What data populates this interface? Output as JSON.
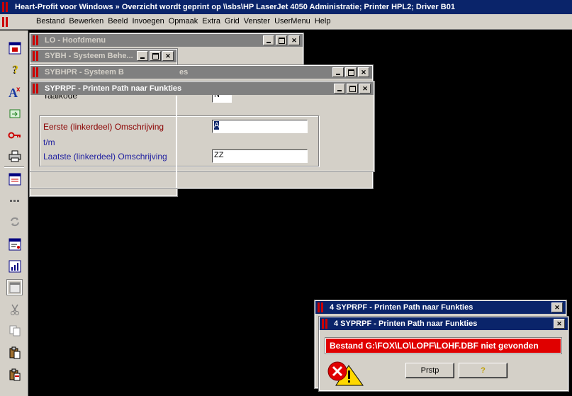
{
  "app": {
    "title": "Heart-Profit voor Windows  »  Overzicht wordt geprint op \\\\sbs\\HP LaserJet 4050 Administratie; Printer HPL2; Driver B01"
  },
  "menu": {
    "items": [
      "Bestand",
      "Bewerken",
      "Beeld",
      "Invoegen",
      "Opmaak",
      "Extra",
      "Grid",
      "Venster",
      "UserMenu",
      "Help"
    ]
  },
  "toolbar": {
    "icons": [
      "frame-icon",
      "help-icon",
      "font-icon",
      "move-icon",
      "key-icon",
      "printer-icon",
      "form-icon",
      "dots-icon",
      "refresh-icon",
      "edit-form-icon",
      "chart-icon",
      "window-icon",
      "scissors-icon",
      "copy-icon",
      "paste-icon",
      "paste-special-icon"
    ]
  },
  "windows": {
    "lo": {
      "title": "LO - Hoofdmenu"
    },
    "sybh": {
      "title": "SYBH - Systeem Behe..."
    },
    "sybhpr": {
      "title": "SYBHPR - Systeem B",
      "title_tail": "es"
    },
    "syprpf": {
      "title": "SYPRPF - Printen Path naar Funkties",
      "partial_label": "Taalkode",
      "partial_value": "N",
      "eerste_label": "Eerste  (linkerdeel) Omschrijving",
      "tm_label": "t/m",
      "laatste_label": "Laatste (linkerdeel) Omschrijving",
      "eerste_value": "A",
      "laatste_value": "ZZ"
    }
  },
  "dialogs": {
    "back": {
      "title": "4 SYPRPF - Printen Path naar Funkties"
    },
    "front": {
      "title": "4 SYPRPF - Printen Path naar Funkties",
      "message": "Bestand G:\\FOX\\LO\\LOPF\\LOHF.DBF niet gevonden",
      "ok_label": "Prstp",
      "help_label": "?"
    }
  },
  "colors": {
    "title_active": "#0a246a",
    "error_banner": "#e00000",
    "label_red": "#8b0000",
    "label_blue": "#2020a0"
  }
}
